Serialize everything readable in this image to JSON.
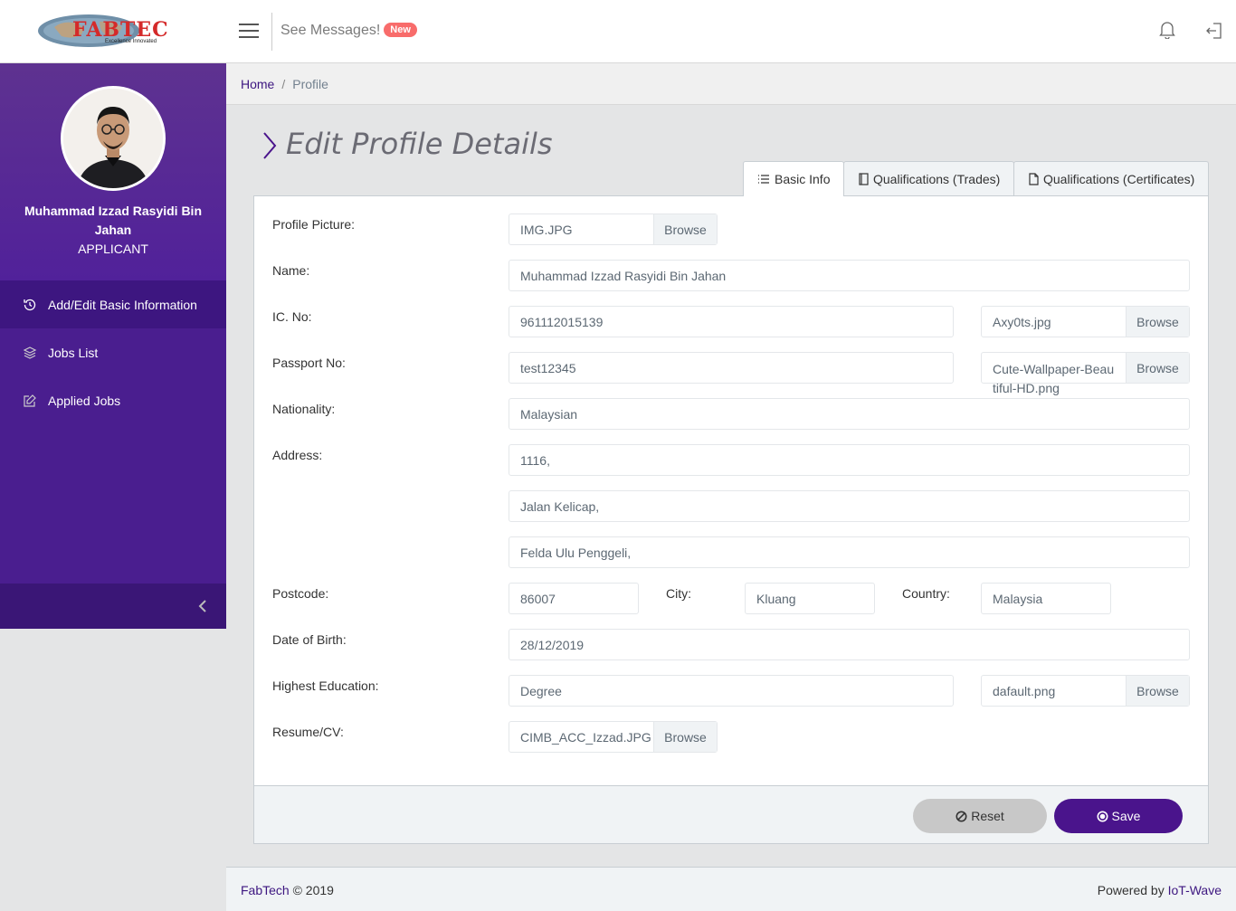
{
  "header": {
    "logo_text": "FABTEC",
    "logo_tagline": "Excellence Innovated",
    "see_messages": "See Messages!",
    "new_badge": "New"
  },
  "sidebar": {
    "user_name": "Muhammad Izzad Rasyidi Bin Jahan",
    "user_role": "APPLICANT",
    "items": [
      {
        "label": "Add/Edit Basic Information",
        "icon": "history-icon"
      },
      {
        "label": "Jobs List",
        "icon": "layers-icon"
      },
      {
        "label": "Applied Jobs",
        "icon": "edit-icon"
      }
    ]
  },
  "breadcrumb": {
    "home": "Home",
    "current": "Profile"
  },
  "page": {
    "title": "Edit Profile Details"
  },
  "tabs": [
    {
      "label": "Basic Info",
      "icon": "list-icon",
      "active": true
    },
    {
      "label": "Qualifications (Trades)",
      "icon": "book-icon",
      "active": false
    },
    {
      "label": "Qualifications (Certificates)",
      "icon": "file-icon",
      "active": false
    }
  ],
  "form": {
    "profile_picture_label": "Profile Picture:",
    "profile_picture_file": "IMG.JPG",
    "browse": "Browse",
    "name_label": "Name:",
    "name_value": "Muhammad Izzad Rasyidi Bin Jahan",
    "ic_label": "IC. No:",
    "ic_value": "961112015139",
    "ic_file": "Axy0ts.jpg",
    "passport_label": "Passport No:",
    "passport_value": "test12345",
    "passport_file": "Cute-Wallpaper-Beautiful-HD.png",
    "nationality_label": "Nationality:",
    "nationality_value": "Malaysian",
    "address_label": "Address:",
    "address_line1": "1116,",
    "address_line2": "Jalan Kelicap,",
    "address_line3": "Felda Ulu Penggeli,",
    "postcode_label": "Postcode:",
    "postcode_value": "86007",
    "city_label": "City:",
    "city_value": "Kluang",
    "country_label": "Country:",
    "country_value": "Malaysia",
    "dob_label": "Date of Birth:",
    "dob_value": "28/12/2019",
    "education_label": "Highest Education:",
    "education_value": "Degree",
    "education_file": "dafault.png",
    "resume_label": "Resume/CV:",
    "resume_file": "CIMB_ACC_Izzad.JPG",
    "reset_label": "Reset",
    "save_label": "Save"
  },
  "footer": {
    "brand": "FabTech",
    "copyright": "© 2019",
    "powered_by": "Powered by",
    "powered_link": "IoT-Wave"
  },
  "colors": {
    "sidebar": "#4a1e8f",
    "primary": "#4a148c",
    "badge": "#f86c6b"
  }
}
